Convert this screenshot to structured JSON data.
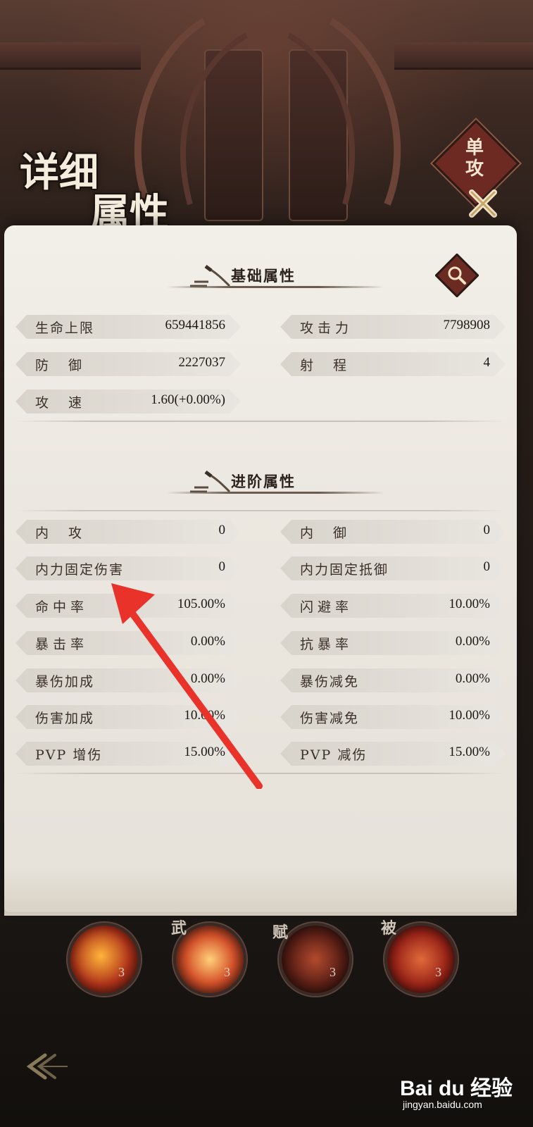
{
  "header": {
    "title_line1": "详细",
    "title_line2": "属性",
    "attack_mode": "单攻"
  },
  "basic": {
    "title": "基础属性",
    "stats": [
      {
        "label": "生命上限",
        "value": "659441856"
      },
      {
        "label": "攻击力",
        "value": "7798908"
      },
      {
        "label": "防御",
        "value": "2227037"
      },
      {
        "label": "射程",
        "value": "4"
      },
      {
        "label": "攻速",
        "value": "1.60(+0.00%)"
      }
    ]
  },
  "advanced": {
    "title": "进阶属性",
    "stats": [
      {
        "label": "内攻",
        "value": "0"
      },
      {
        "label": "内御",
        "value": "0"
      },
      {
        "label": "内力固定伤害",
        "value": "0"
      },
      {
        "label": "内力固定抵御",
        "value": "0"
      },
      {
        "label": "命中率",
        "value": "105.00%"
      },
      {
        "label": "闪避率",
        "value": "10.00%"
      },
      {
        "label": "暴击率",
        "value": "0.00%"
      },
      {
        "label": "抗暴率",
        "value": "0.00%"
      },
      {
        "label": "暴伤加成",
        "value": "0.00%"
      },
      {
        "label": "暴伤减免",
        "value": "0.00%"
      },
      {
        "label": "伤害加成",
        "value": "10.00%"
      },
      {
        "label": "伤害减免",
        "value": "10.00%"
      },
      {
        "label": "PVP 增伤",
        "value": "15.00%"
      },
      {
        "label": "PVP 减伤",
        "value": "15.00%"
      }
    ]
  },
  "skills": [
    {
      "tag": "",
      "level": "3"
    },
    {
      "tag": "武",
      "level": "3"
    },
    {
      "tag": "赋",
      "level": "3"
    },
    {
      "tag": "被",
      "level": "3"
    }
  ],
  "watermark": {
    "main": "Bai du 经验",
    "sub": "jingyan.baidu.com"
  },
  "colors": {
    "panel": "#ece8e1",
    "accent_red": "#e8322a",
    "badge_red": "#6c2a22"
  },
  "icons": [
    "search-icon",
    "close-icon",
    "back-arrow-icon",
    "brush-icon"
  ]
}
